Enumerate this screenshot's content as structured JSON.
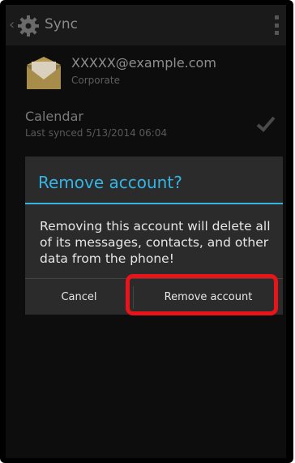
{
  "actionbar": {
    "title": "Sync",
    "back_icon": "chevron-left-icon",
    "app_icon": "gear-icon",
    "menu_icon": "overflow-menu-icon"
  },
  "account": {
    "email": "XXXXX@example.com",
    "type": "Corporate",
    "icon": "email-envelope-icon"
  },
  "sync_item": {
    "label": "Calendar",
    "last_synced": "Last synced 5/13/2014 06:04",
    "checked": true
  },
  "dialog": {
    "title": "Remove account?",
    "message": "Removing this account will delete all of its messages, contacts, and other data from the phone!",
    "cancel_label": "Cancel",
    "remove_label": "Remove account",
    "accent_color": "#33b5e5",
    "highlight_color": "#e8141a"
  }
}
